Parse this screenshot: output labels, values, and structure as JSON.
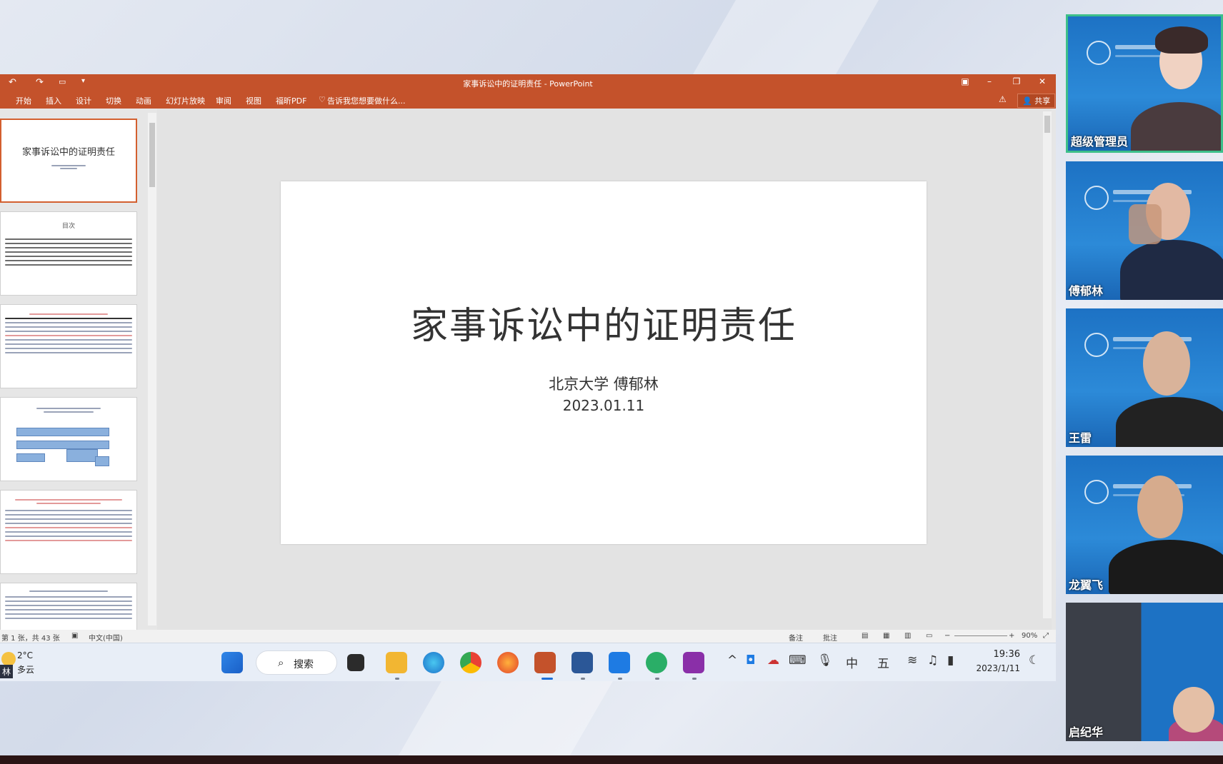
{
  "powerpoint": {
    "window_title": "家事诉讼中的证明责任 - PowerPoint",
    "quick_access": {
      "undo": "↶",
      "redo": "↷"
    },
    "ribbon_tabs": [
      "开始",
      "插入",
      "设计",
      "切换",
      "动画",
      "幻灯片放映",
      "审阅",
      "视图",
      "福昕PDF"
    ],
    "tell_me": "告诉我您想要做什么...",
    "share_label": "共享",
    "slide": {
      "title": "家事诉讼中的证明责任",
      "author": "北京大学 傅郁林",
      "date": "2023.01.11"
    },
    "thumbnails": {
      "slide1_title": "家事诉讼中的证明责任",
      "slide2_title": "目次"
    },
    "status": {
      "slide_counter": "第 1 张，共 43 张",
      "language": "中文(中国)",
      "notes": "备注",
      "comments": "批注",
      "zoom": "90%"
    }
  },
  "taskbar": {
    "weather_temp": "2°C",
    "weather_desc": "多云",
    "name_chip": "林",
    "search_label": "搜索",
    "ime_lang": "中",
    "ime_mode": "五",
    "time": "19:36",
    "date": "2023/1/11"
  },
  "participants": [
    {
      "name": "超级管理员",
      "active": true
    },
    {
      "name": "傅郁林",
      "active": false
    },
    {
      "name": "王雷",
      "active": false
    },
    {
      "name": "龙翼飞",
      "active": false
    },
    {
      "name": "启纪华",
      "active": false
    }
  ],
  "colors": {
    "ppt_accent": "#c4522b",
    "video_bg": "#1d72c4",
    "active_speaker": "#3dbf8a"
  }
}
